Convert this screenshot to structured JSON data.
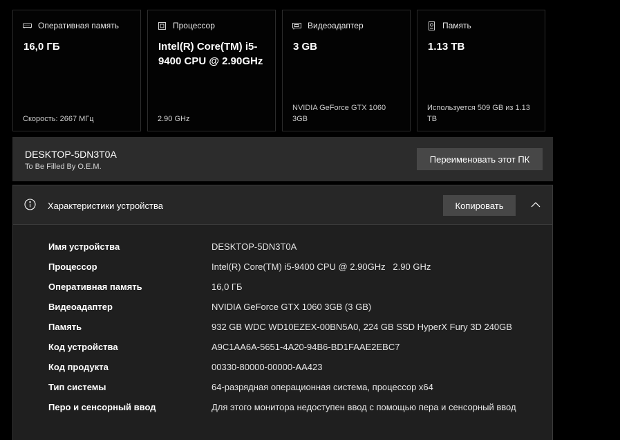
{
  "cards": [
    {
      "icon": "ram-icon",
      "title": "Оперативная память",
      "value": "16,0 ГБ",
      "foot": "Скорость: 2667 МГц"
    },
    {
      "icon": "cpu-icon",
      "title": "Процессор",
      "value": "Intel(R) Core(TM) i5-9400 CPU @ 2.90GHz",
      "foot": "2.90 GHz"
    },
    {
      "icon": "gpu-icon",
      "title": "Видеоадаптер",
      "value": "3 GB",
      "foot": "NVIDIA GeForce GTX 1060 3GB"
    },
    {
      "icon": "storage-icon",
      "title": "Память",
      "value": "1.13 TB",
      "foot": "Используется 509 GB из 1.13 TB"
    }
  ],
  "pc": {
    "name": "DESKTOP-5DN3T0A",
    "model": "To Be Filled By O.E.M.",
    "rename_label": "Переименовать этот ПК"
  },
  "specs": {
    "title": "Характеристики устройства",
    "copy_label": "Копировать",
    "rows": [
      {
        "key": "Имя устройства",
        "value": "DESKTOP-5DN3T0A"
      },
      {
        "key": "Процессор",
        "value": "Intel(R) Core(TM) i5-9400 CPU @ 2.90GHz   2.90 GHz"
      },
      {
        "key": "Оперативная память",
        "value": "16,0 ГБ"
      },
      {
        "key": "Видеоадаптер",
        "value": "NVIDIA GeForce GTX 1060 3GB (3 GB)"
      },
      {
        "key": "Память",
        "value": "932 GB WDC WD10EZEX-00BN5A0, 224 GB SSD HyperX Fury 3D 240GB"
      },
      {
        "key": "Код устройства",
        "value": "A9C1AA6A-5651-4A20-94B6-BD1FAAE2EBC7"
      },
      {
        "key": "Код продукта",
        "value": "00330-80000-00000-AA423"
      },
      {
        "key": "Тип системы",
        "value": "64-разрядная операционная система, процессор x64"
      },
      {
        "key": "Перо и сенсорный ввод",
        "value": "Для этого монитора недоступен ввод с помощью пера и сенсорный ввод"
      }
    ]
  }
}
